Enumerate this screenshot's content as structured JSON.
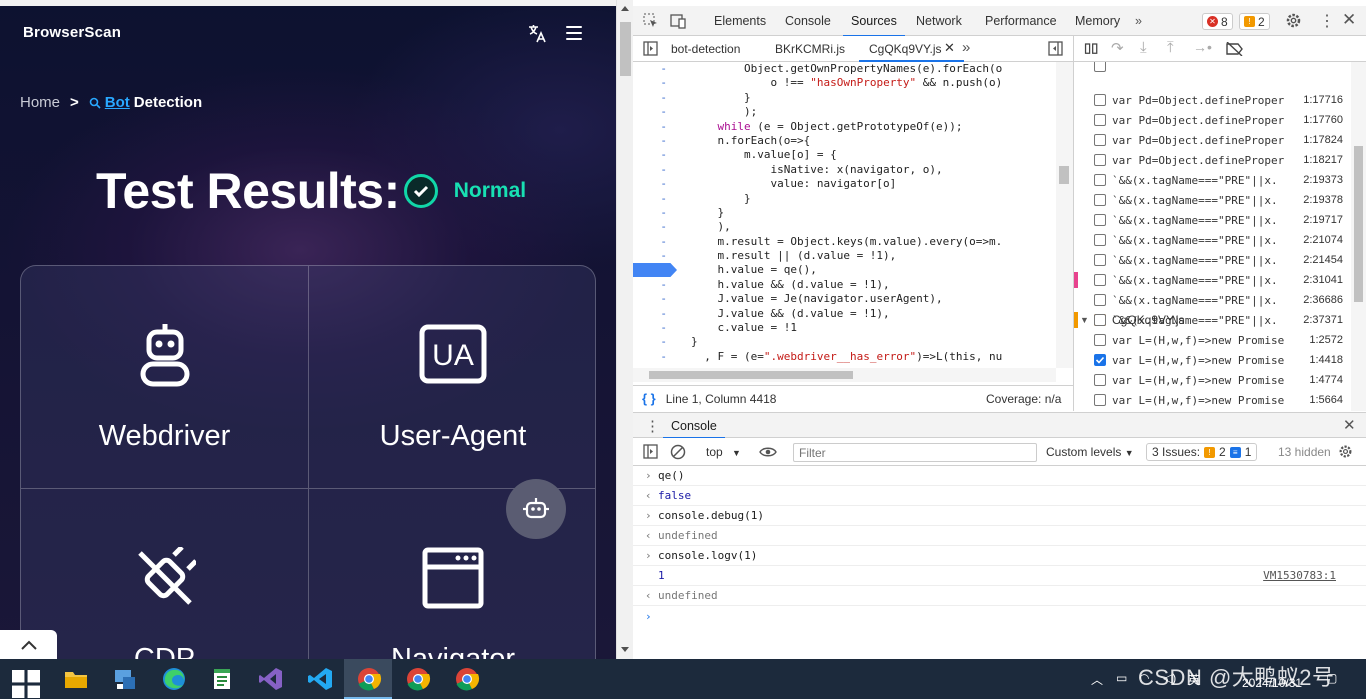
{
  "page": {
    "logo": "BrowserScan",
    "breadcrumb": {
      "home": "Home",
      "sep": ">",
      "bot": "Bot",
      "detection": "Detection"
    },
    "title": "Test Results:",
    "status": "Normal",
    "cards": [
      {
        "label": "Webdriver"
      },
      {
        "label": "User-Agent"
      },
      {
        "label": "CDP"
      },
      {
        "label": "Navigator"
      }
    ]
  },
  "devtools": {
    "tabs": [
      "Elements",
      "Console",
      "Sources",
      "Network",
      "Performance",
      "Memory"
    ],
    "active_tab": "Sources",
    "errors": "8",
    "warnings": "2",
    "files": [
      "bot-detection",
      "BKrKCMRi.js",
      "CgQKq9VY.js"
    ],
    "code_lines": [
      "        Object.getOwnPropertyNames(e).forEach(o",
      "            o !== \"hasOwnProperty\" && n.push(o)",
      "        }",
      "        );",
      "    while (e = Object.getPrototypeOf(e));",
      "    n.forEach(o=>{",
      "        m.value[o] = {",
      "            isNative: x(navigator, o),",
      "            value: navigator[o]",
      "        }",
      "    }",
      "    ),",
      "    m.result = Object.keys(m.value).every(o=>m.",
      "    m.result || (d.value = !1),",
      "    h.value = qe(),",
      "    h.value && (d.value = !1),",
      "    J.value = Je(navigator.userAgent),",
      "    J.value && (d.value = !1),",
      "    c.value = !1",
      "}",
      "  , F = (e=\".webdriver__has_error\")=>L(this, nu"
    ],
    "gutter_mark": "-",
    "status_position": "Line 1, Column 4418",
    "coverage": "Coverage: n/a",
    "breakpoints": [
      {
        "text": "var Pd=Object.defineProper",
        "line": "1:17716",
        "checked": false
      },
      {
        "text": "var Pd=Object.defineProper",
        "line": "1:17760",
        "checked": false
      },
      {
        "text": "var Pd=Object.defineProper",
        "line": "1:17824",
        "checked": false
      },
      {
        "text": "var Pd=Object.defineProper",
        "line": "1:18217",
        "checked": false
      },
      {
        "text": "`&&(x.tagName===\"PRE\"||x.",
        "line": "2:19373",
        "checked": false
      },
      {
        "text": "`&&(x.tagName===\"PRE\"||x.",
        "line": "2:19378",
        "checked": false
      },
      {
        "text": "`&&(x.tagName===\"PRE\"||x.",
        "line": "2:19717",
        "checked": false
      },
      {
        "text": "`&&(x.tagName===\"PRE\"||x.",
        "line": "2:21074",
        "checked": false
      },
      {
        "text": "`&&(x.tagName===\"PRE\"||x.",
        "line": "2:21454",
        "checked": false
      },
      {
        "text": "`&&(x.tagName===\"PRE\"||x.",
        "line": "2:31041",
        "checked": false
      },
      {
        "text": "`&&(x.tagName===\"PRE\"||x.",
        "line": "2:36686",
        "checked": false
      },
      {
        "text": "`&&(x.tagName===\"PRE\"||x.",
        "line": "2:37371",
        "checked": false
      }
    ],
    "bp_group": "CgQKq9VY.js",
    "bp_group2": [
      {
        "text": "var L=(H,w,f)=>new Promise",
        "line": "1:2572",
        "checked": false
      },
      {
        "text": "var L=(H,w,f)=>new Promise",
        "line": "1:4418",
        "checked": true
      },
      {
        "text": "var L=(H,w,f)=>new Promise",
        "line": "1:4774",
        "checked": false
      },
      {
        "text": "var L=(H,w,f)=>new Promise",
        "line": "1:5664",
        "checked": false
      }
    ],
    "drawer_tab": "Console",
    "context": "top",
    "filter_placeholder": "Filter",
    "levels": "Custom levels",
    "issues_label": "3 Issues:",
    "issues_warn": "2",
    "issues_info": "1",
    "hidden": "13 hidden",
    "console": [
      {
        "type": "in",
        "text": "qe()"
      },
      {
        "type": "out",
        "text": "false",
        "style": "blue"
      },
      {
        "type": "in",
        "text": "console.debug(1)"
      },
      {
        "type": "out",
        "text": "undefined",
        "style": "muted"
      },
      {
        "type": "in",
        "text": "console.logv(1)"
      },
      {
        "type": "log",
        "text": "1",
        "style": "blue",
        "src": "VM1530783:1"
      },
      {
        "type": "out",
        "text": "undefined",
        "style": "muted"
      }
    ]
  },
  "taskbar": {
    "watermark": "CSDN @大鸭蚁2号",
    "date": "2024/10/31",
    "ime": "英"
  }
}
